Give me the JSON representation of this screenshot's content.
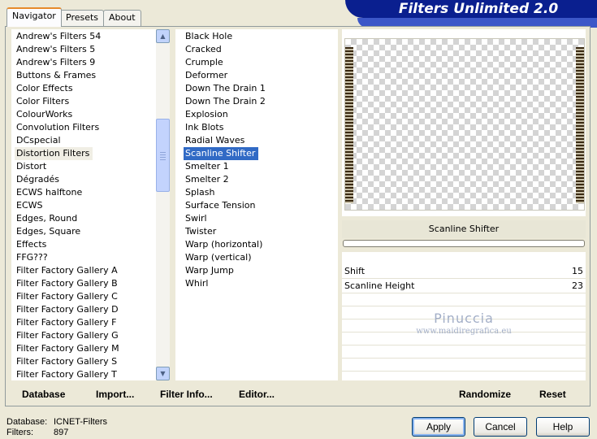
{
  "tabs": [
    {
      "label": "Navigator",
      "active": true
    },
    {
      "label": "Presets",
      "active": false
    },
    {
      "label": "About",
      "active": false
    }
  ],
  "app_title": "Filters Unlimited 2.0",
  "categories": [
    "Andrew's Filters 54",
    "Andrew's Filters 5",
    "Andrew's Filters 9",
    "Buttons & Frames",
    "Color Effects",
    "Color Filters",
    "ColourWorks",
    "Convolution Filters",
    "DCspecial",
    "Distortion Filters",
    "Distort",
    "Dégradés",
    "ECWS halftone",
    "ECWS",
    "Edges, Round",
    "Edges, Square",
    "Effects",
    "FFG???",
    "Filter Factory Gallery A",
    "Filter Factory Gallery B",
    "Filter Factory Gallery C",
    "Filter Factory Gallery D",
    "Filter Factory Gallery F",
    "Filter Factory Gallery G",
    "Filter Factory Gallery M",
    "Filter Factory Gallery S",
    "Filter Factory Gallery T"
  ],
  "selected_category": "Distortion Filters",
  "filters": [
    "Black Hole",
    "Cracked",
    "Crumple",
    "Deformer",
    "Down The Drain 1",
    "Down The Drain 2",
    "Explosion",
    "Ink Blots",
    "Radial Waves",
    "Scanline Shifter",
    "Smelter 1",
    "Smelter 2",
    "Splash",
    "Surface Tension",
    "Swirl",
    "Twister",
    "Warp (horizontal)",
    "Warp (vertical)",
    "Warp Jump",
    "Whirl"
  ],
  "selected_filter": "Scanline Shifter",
  "preview": {
    "filter_name": "Scanline Shifter"
  },
  "parameters": [
    {
      "label": "Shift",
      "value": "15"
    },
    {
      "label": "Scanline Height",
      "value": "23"
    }
  ],
  "watermark": {
    "line1": "Pinuccia",
    "line2": "www.maidiregrafica.eu"
  },
  "bottom_bar": {
    "database": "Database",
    "import": "Import...",
    "filter_info": "Filter Info...",
    "editor": "Editor...",
    "randomize": "Randomize",
    "reset": "Reset"
  },
  "status": {
    "database_label": "Database:",
    "database_value": "ICNET-Filters",
    "filters_label": "Filters:",
    "filters_value": "897"
  },
  "dialog_buttons": {
    "apply": "Apply",
    "cancel": "Cancel",
    "help": "Help"
  }
}
